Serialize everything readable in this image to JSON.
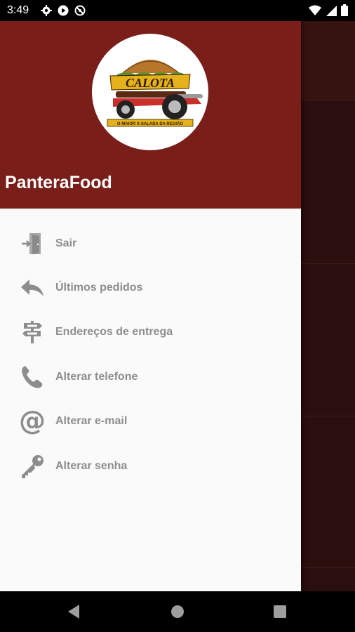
{
  "status_bar": {
    "time": "3:49",
    "left_icons": [
      "gear-icon",
      "play-icon",
      "blocked-icon"
    ],
    "right_icons": [
      "wifi-icon",
      "signal-icon",
      "battery-icon"
    ]
  },
  "drawer": {
    "header_color": "#7a1e1a",
    "app_name": "PanteraFood",
    "logo": {
      "brand_text": "CALOTA",
      "tagline": "O MAIOR X-SALADA DA REGIÃO"
    },
    "menu_items": [
      {
        "label": "Sair",
        "icon": "exit-door-icon"
      },
      {
        "label": "Últimos pedidos",
        "icon": "reply-arrow-icon"
      },
      {
        "label": "Endereços de entrega",
        "icon": "signpost-icon"
      },
      {
        "label": "Alterar telefone",
        "icon": "phone-icon"
      },
      {
        "label": "Alterar e-mail",
        "icon": "at-sign-icon"
      },
      {
        "label": "Alterar senha",
        "icon": "key-icon"
      }
    ]
  },
  "nav_bar": {
    "buttons": [
      "back-icon",
      "home-icon",
      "recents-icon"
    ]
  }
}
